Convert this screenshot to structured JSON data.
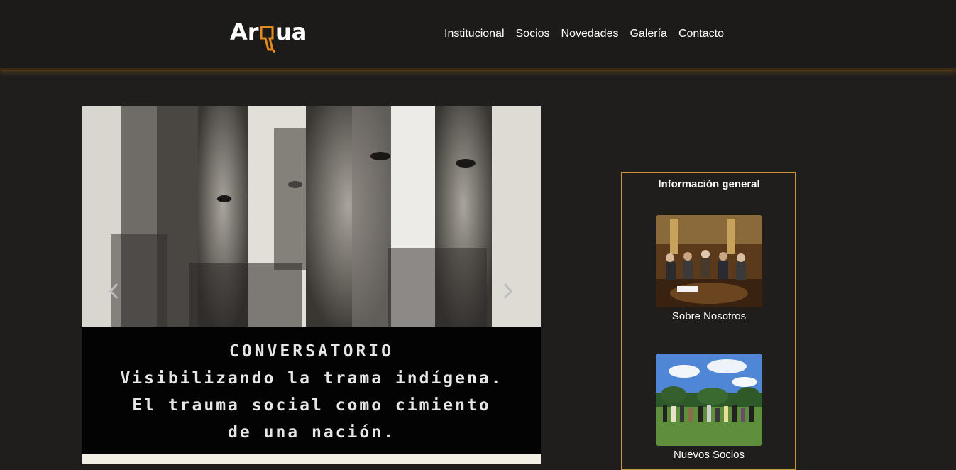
{
  "header": {
    "logo_text": "Ar ua",
    "nav": [
      {
        "label": "Institucional"
      },
      {
        "label": "Socios"
      },
      {
        "label": "Novedades"
      },
      {
        "label": "Galería"
      },
      {
        "label": "Contacto"
      }
    ]
  },
  "slider": {
    "caption": {
      "line1": "CONVERSATORIO",
      "line2": "Visibilizando la trama indígena.",
      "line3": "El trauma social como cimiento",
      "line4": "de una nación."
    }
  },
  "info": {
    "title": "Información general",
    "cards": [
      {
        "label": "Sobre Nosotros"
      },
      {
        "label": "Nuevos Socios"
      }
    ]
  },
  "colors": {
    "background": "#1f1e1d",
    "accent": "#c8963c",
    "logo_accent": "#e38b1a"
  }
}
